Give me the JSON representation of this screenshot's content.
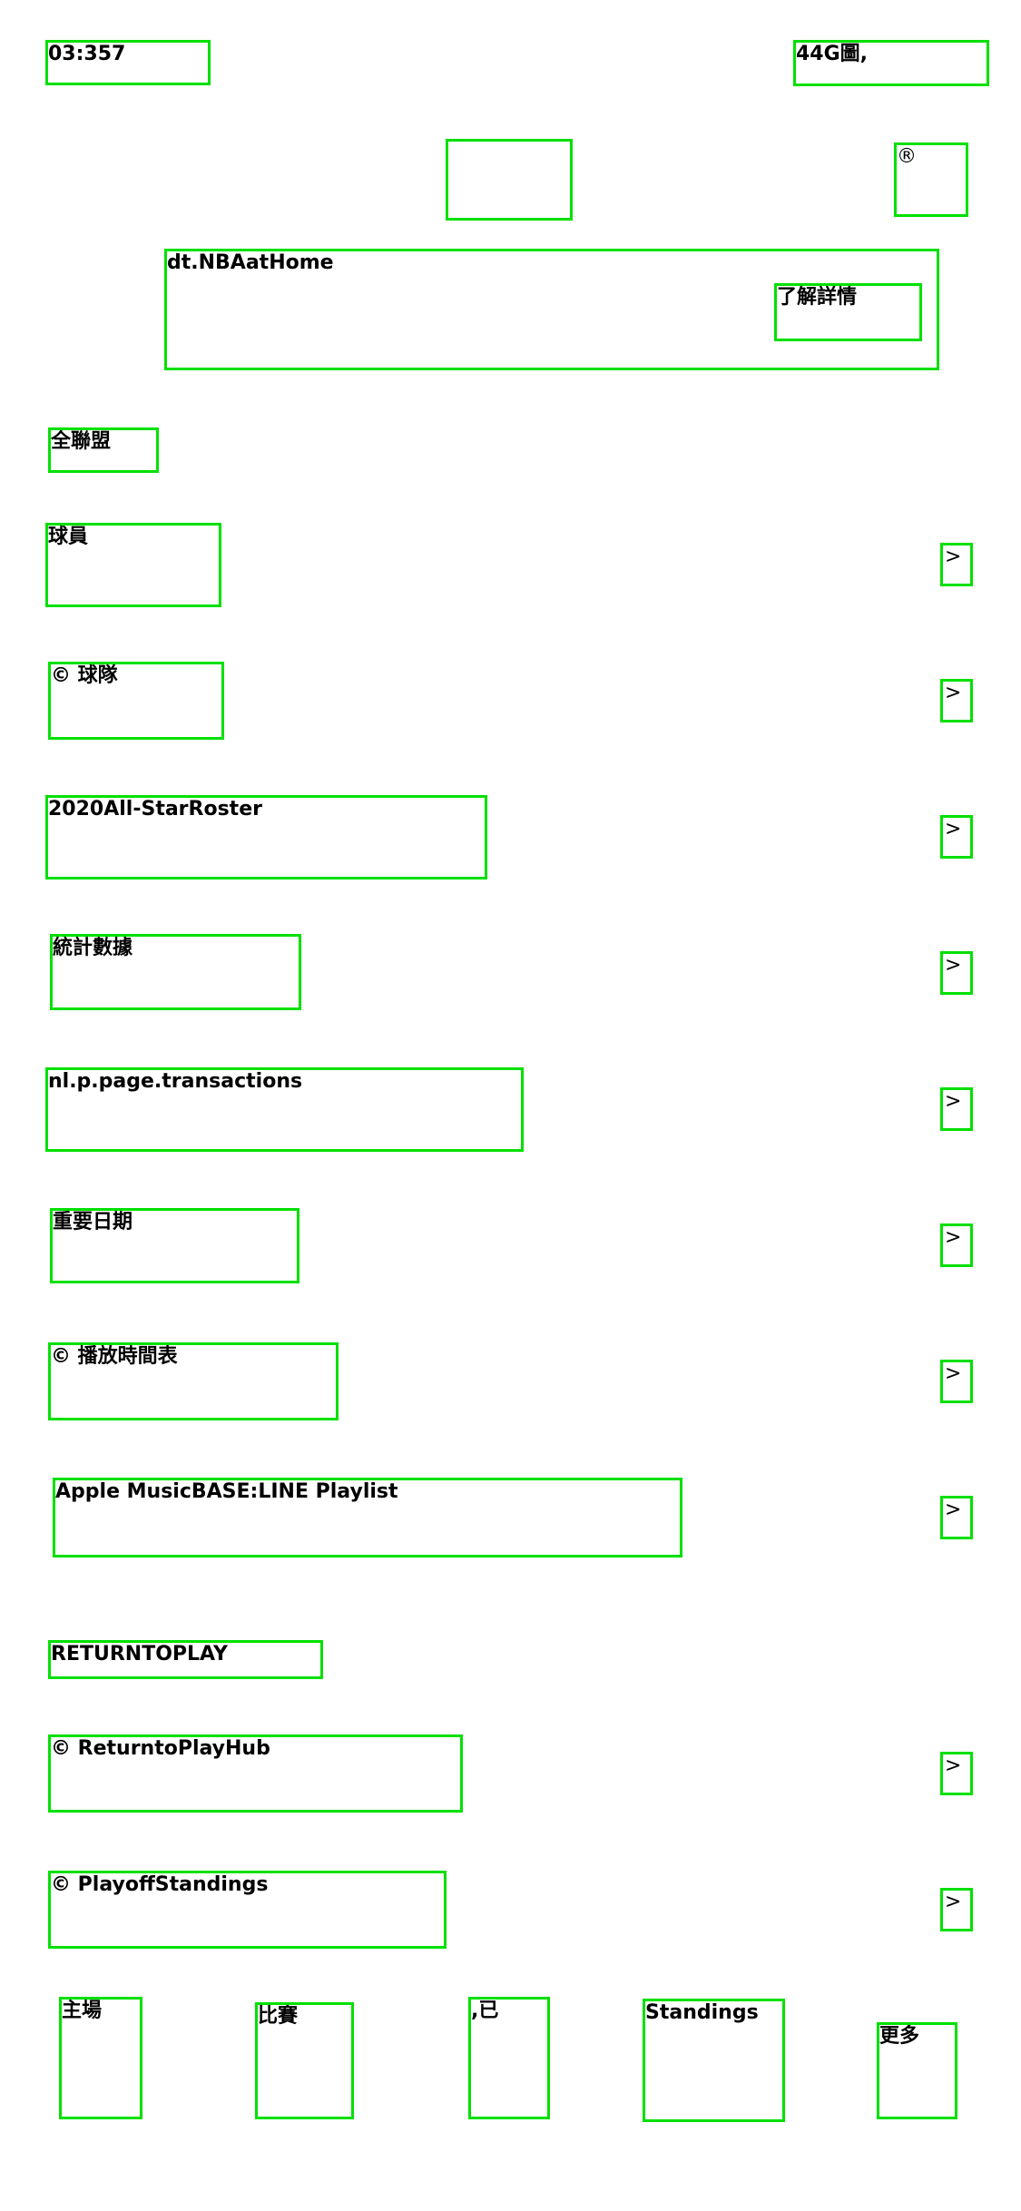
{
  "status_bar": {
    "time": "03:357",
    "signal": "44G圖,"
  },
  "header": {
    "logo_text": "",
    "profile_icon": "®"
  },
  "banner": {
    "title": "dt.NBAatHome",
    "cta_label": "了解詳情"
  },
  "section_league": {
    "heading": "全聯盟",
    "items": [
      {
        "label": "球員",
        "chevron": ">"
      },
      {
        "label": "© 球隊",
        "chevron": ">"
      },
      {
        "label": "2020All-StarRoster",
        "chevron": ">"
      },
      {
        "label": "統計數據",
        "chevron": ">"
      },
      {
        "label": "nl.p.page.transactions",
        "chevron": ">"
      },
      {
        "label": "重要日期",
        "chevron": ">"
      },
      {
        "label": "© 播放時間表",
        "chevron": ">"
      },
      {
        "label": "Apple MusicBASE:LINE Playlist",
        "chevron": ">"
      }
    ]
  },
  "section_return": {
    "heading": "RETURNTOPLAY",
    "items": [
      {
        "label": "© ReturntoPlayHub",
        "chevron": ">"
      },
      {
        "label": "© PlayoffStandings",
        "chevron": ">"
      }
    ]
  },
  "tab_bar": {
    "tabs": [
      {
        "label": "主場"
      },
      {
        "label": "比賽"
      },
      {
        "label": ",已"
      },
      {
        "label": "Standings"
      },
      {
        "label": "更多"
      }
    ]
  },
  "colors": {
    "outline": "#00e000",
    "text": "#000000",
    "background": "#ffffff"
  }
}
